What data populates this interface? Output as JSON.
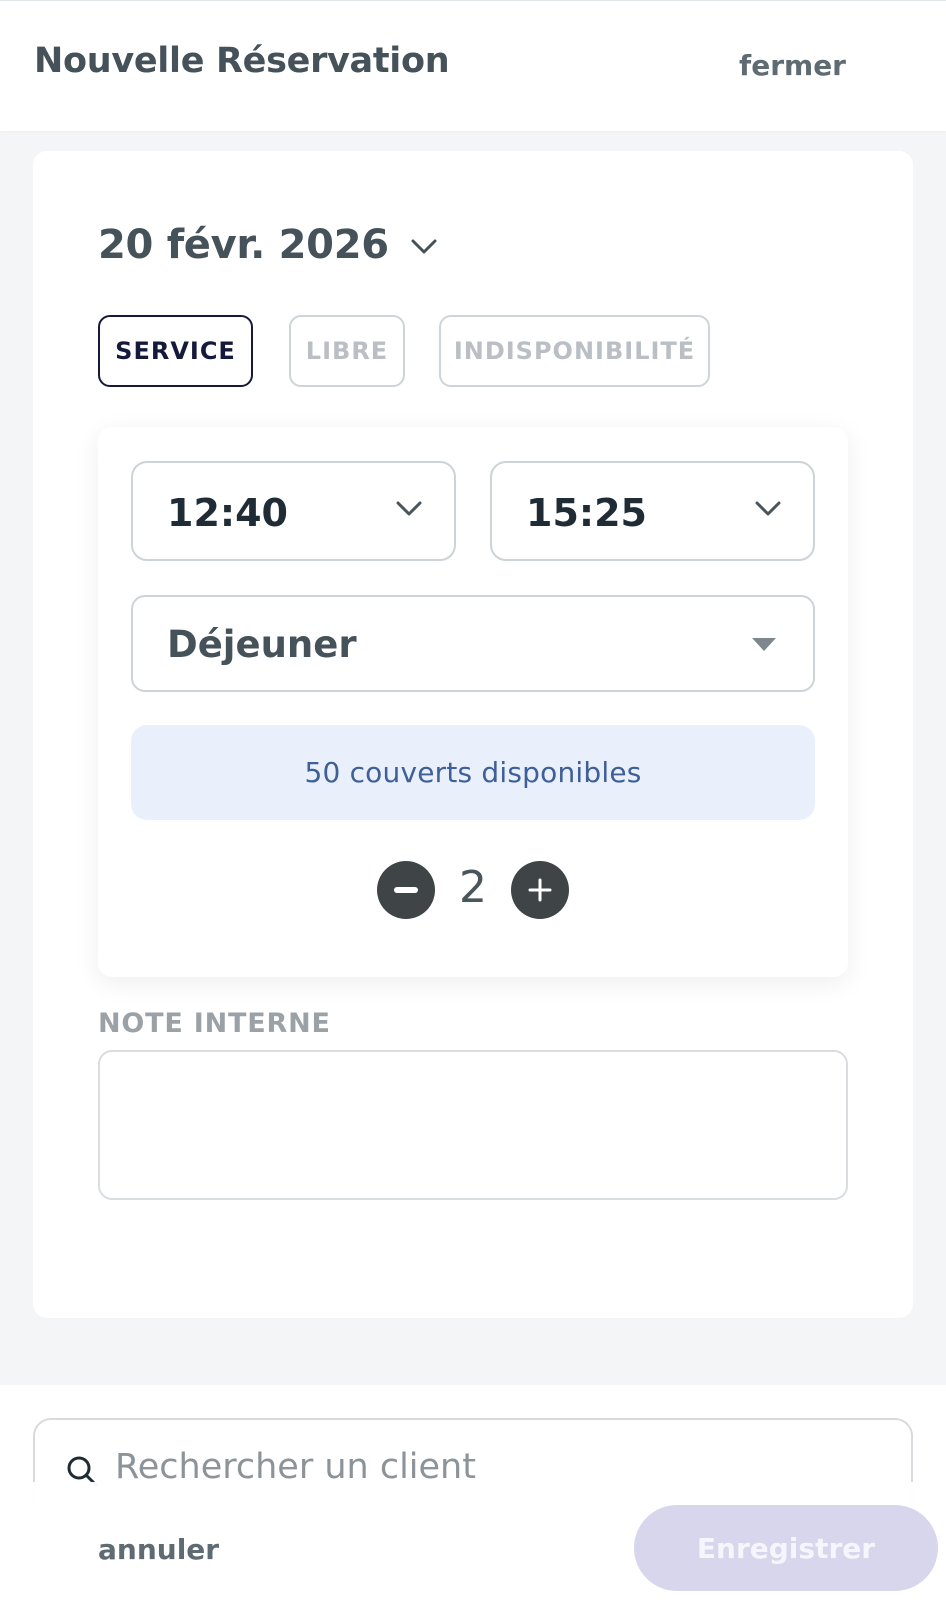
{
  "header": {
    "title": "Nouvelle Réservation",
    "close_label": "fermer"
  },
  "date": {
    "value": "20 févr. 2026",
    "icon": "chevron-down-icon"
  },
  "type_tabs": [
    {
      "label": "SERVICE",
      "active": true
    },
    {
      "label": "LIBRE",
      "active": false
    },
    {
      "label": "INDISPONIBILITÉ",
      "active": false
    }
  ],
  "time": {
    "start": "12:40",
    "end": "15:25"
  },
  "service": {
    "selected": "Déjeuner"
  },
  "availability": {
    "text": "50 couverts disponibles"
  },
  "guests": {
    "count": "2"
  },
  "note": {
    "label": "NOTE INTERNE",
    "value": ""
  },
  "search": {
    "placeholder": "Rechercher un client",
    "icon": "search-icon"
  },
  "footer": {
    "cancel_label": "annuler",
    "save_label": "Enregistrer"
  },
  "colors": {
    "active_border": "#151a3a",
    "availability_bg": "#e9f0fc",
    "availability_text": "#3e5f98",
    "save_bg": "#d7d6ec",
    "stepper_bg": "#3f4447"
  }
}
